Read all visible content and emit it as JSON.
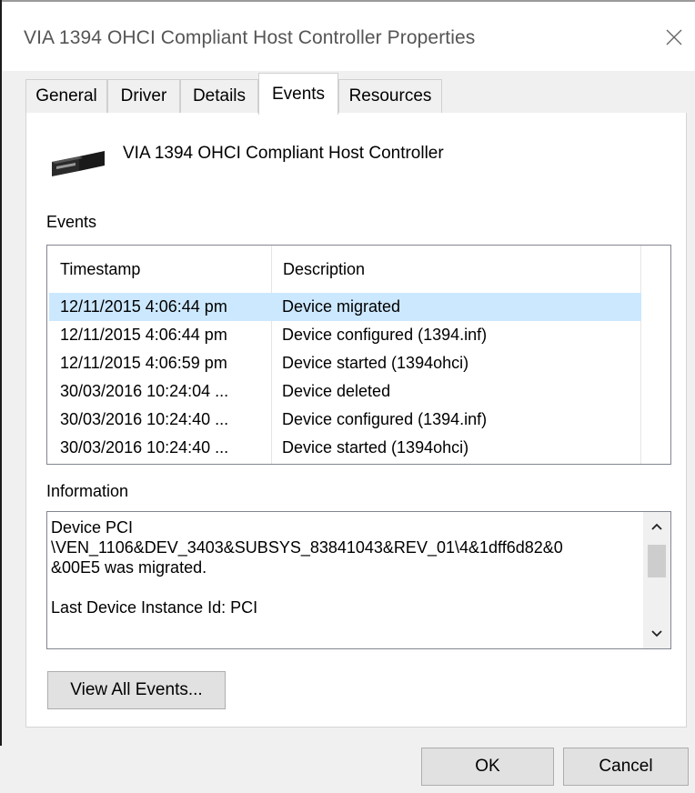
{
  "window": {
    "title": "VIA 1394 OHCI Compliant Host Controller Properties",
    "close_icon": "close-icon"
  },
  "tabs": [
    {
      "label": "General"
    },
    {
      "label": "Driver"
    },
    {
      "label": "Details"
    },
    {
      "label": "Events"
    },
    {
      "label": "Resources"
    }
  ],
  "active_tab": "Events",
  "device": {
    "icon": "usb-connector-icon",
    "name": "VIA 1394 OHCI Compliant Host Controller"
  },
  "events": {
    "label": "Events",
    "columns": {
      "timestamp": "Timestamp",
      "description": "Description"
    },
    "rows": [
      {
        "timestamp": "12/11/2015 4:06:44 pm",
        "description": "Device migrated",
        "selected": true
      },
      {
        "timestamp": "12/11/2015 4:06:44 pm",
        "description": "Device configured (1394.inf)"
      },
      {
        "timestamp": "12/11/2015 4:06:59 pm",
        "description": "Device started (1394ohci)"
      },
      {
        "timestamp": "30/03/2016 10:24:04 ...",
        "description": "Device deleted"
      },
      {
        "timestamp": "30/03/2016 10:24:40 ...",
        "description": "Device configured (1394.inf)"
      },
      {
        "timestamp": "30/03/2016 10:24:40 ...",
        "description": "Device started (1394ohci)"
      }
    ]
  },
  "information": {
    "label": "Information",
    "lines": [
      "Device PCI",
      "\\VEN_1106&DEV_3403&SUBSYS_83841043&REV_01\\4&1dff6d82&0",
      "&00E5 was migrated.",
      "",
      "Last Device Instance Id: PCI"
    ]
  },
  "buttons": {
    "view_all": "View All Events...",
    "ok": "OK",
    "cancel": "Cancel"
  },
  "colors": {
    "selection": "#cce8ff",
    "window_bg": "#f0f0f0",
    "panel_bg": "#ffffff",
    "border": "#828790"
  }
}
